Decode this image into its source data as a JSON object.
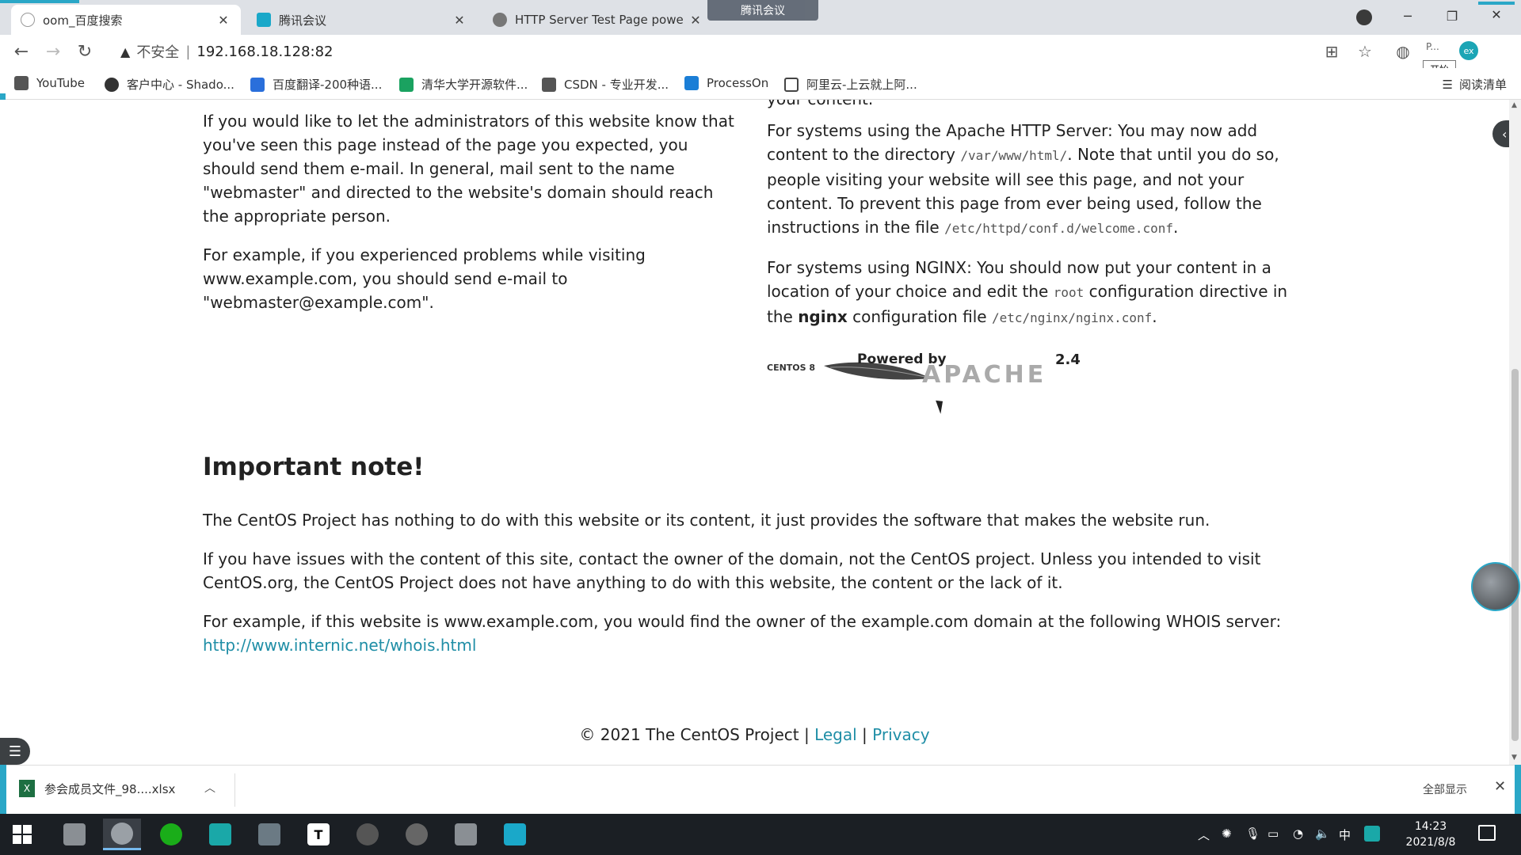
{
  "browser": {
    "tabs": [
      {
        "title": "oom_百度搜索",
        "active": true,
        "icon": "baidu-paw-icon"
      },
      {
        "title": "腾讯会议",
        "active": false,
        "icon": "tencent-meeting-icon"
      },
      {
        "title": "HTTP Server Test Page powe",
        "active": false,
        "icon": "globe-icon"
      }
    ],
    "meeting_badge": "腾讯会议",
    "address": {
      "security_label": "不安全",
      "url": "192.168.18.128:82"
    },
    "extension_text": "P...",
    "extension_avatar": "ex",
    "tooltip": "开始",
    "bookmarks": [
      {
        "label": "YouTube",
        "color": "#555555"
      },
      {
        "label": "客户中心 - Shado...",
        "color": "#333333"
      },
      {
        "label": "百度翻译-200种语...",
        "color": "#2a6fdb"
      },
      {
        "label": "清华大学开源软件...",
        "color": "#1aa260"
      },
      {
        "label": "CSDN - 专业开发...",
        "color": "#555555"
      },
      {
        "label": "ProcessOn",
        "color": "#1b7ed6"
      },
      {
        "label": "阿里云-上云就上阿...",
        "color": "#444444"
      }
    ],
    "reading_list": "阅读清单"
  },
  "page": {
    "left_col": {
      "p1": "If you would like to let the administrators of this website know that you've seen this page instead of the page you expected, you should send them e-mail. In general, mail sent to the name \"webmaster\" and directed to the website's domain should reach the appropriate person.",
      "p2": "For example, if you experienced problems while visiting www.example.com, you should send e-mail to \"webmaster@example.com\"."
    },
    "right_col": {
      "top_line": "your content.",
      "apache_a": "For systems using the Apache HTTP Server: You may now add content to the directory ",
      "apache_dir": "/var/www/html/",
      "apache_b": ". Note that until you do so, people visiting your website will see this page, and not your content. To prevent this page from ever being used, follow the instructions in the file ",
      "apache_file": "/etc/httpd/conf.d/welcome.conf",
      "apache_end": ".",
      "nginx_a": "For systems using NGINX: You should now put your content in a location of your choice and edit the ",
      "nginx_root": "root",
      "nginx_b": " configuration directive in the ",
      "nginx_bold": "nginx",
      "nginx_c": " configuration file ",
      "nginx_file": "/etc/nginx/nginx.conf",
      "nginx_end": "."
    },
    "powered": {
      "centos": "CENTOS 8",
      "powered_by": "Powered by",
      "version": "2.4",
      "apache": "APACHE"
    },
    "important_heading": "Important note!",
    "important": {
      "p1": "The CentOS Project has nothing to do with this website or its content, it just provides the software that makes the website run.",
      "p2": "If you have issues with the content of this site, contact the owner of the domain, not the CentOS project. Unless you intended to visit CentOS.org, the CentOS Project does not have anything to do with this website, the content or the lack of it.",
      "p3": "For example, if this website is www.example.com, you would find the owner of the example.com domain at the following WHOIS server:",
      "whois_link": "http://www.internic.net/whois.html"
    },
    "footer": {
      "copyright": "© 2021 The CentOS Project",
      "sep": "|",
      "legal": "Legal",
      "privacy": "Privacy"
    }
  },
  "downloads": {
    "file": "参会成员文件_98....xlsx",
    "show_all": "全部显示"
  },
  "taskbar": {
    "time": "14:23",
    "date": "2021/8/8",
    "ime": "中",
    "apps": [
      "photo-app",
      "chrome-browser",
      "wechat",
      "task-view",
      "file-explorer",
      "typora",
      "netease-music",
      "snail-app",
      "photo-app-2",
      "tencent-meeting"
    ]
  }
}
